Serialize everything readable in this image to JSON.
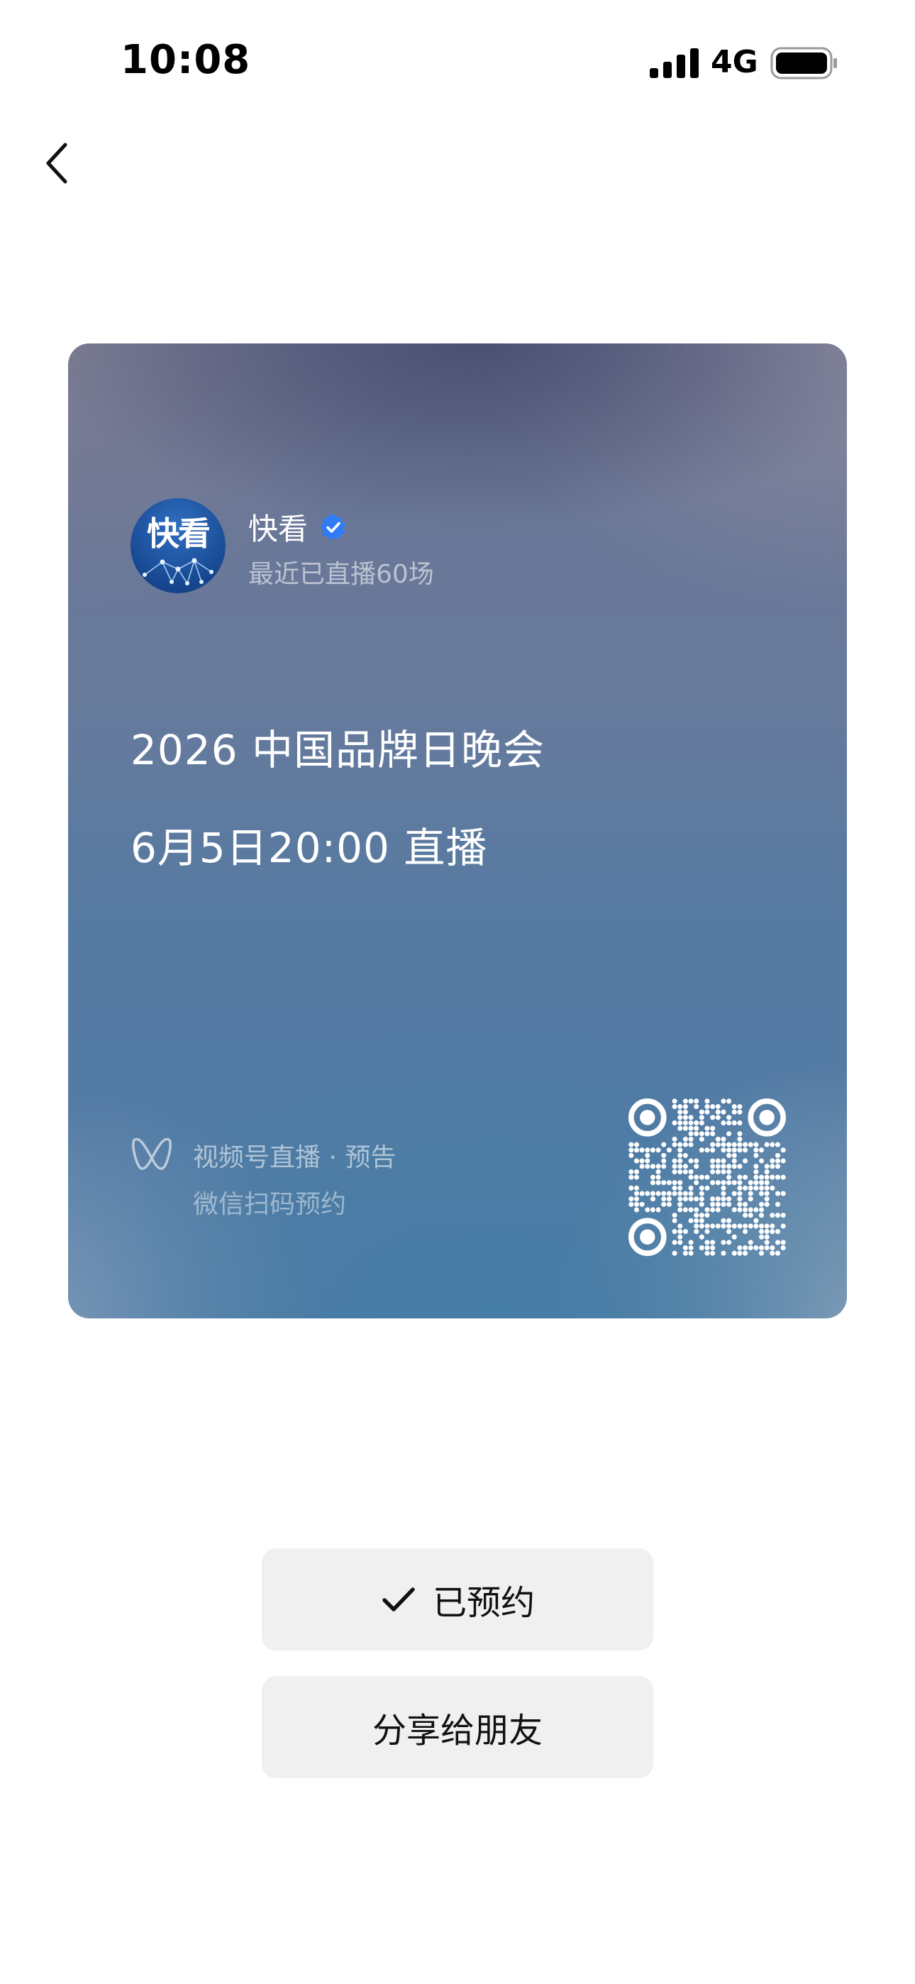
{
  "status_bar": {
    "time": "10:08",
    "network": "4G",
    "icons": [
      "signal-icon",
      "battery-icon"
    ]
  },
  "nav": {
    "back_icon": "chevron-left-icon"
  },
  "card": {
    "avatar_text": "快看",
    "channel_name": "快看",
    "verified_icon": "verified-badge-icon",
    "live_count": "最近已直播60场",
    "event_title": "2026 中国品牌日晚会",
    "event_time": "6月5日20:00 直播",
    "footer_icon": "channels-logo-icon",
    "footer_title": "视频号直播 · 预告",
    "footer_subtitle": "微信扫码预约",
    "qr_icon": "qr-code-icon"
  },
  "actions": {
    "reserved_label": "已预约",
    "reserved_icon": "checkmark-icon",
    "share_label": "分享给朋友"
  },
  "colors": {
    "verified": "#2f7cf6",
    "button_bg": "#f0f0f0",
    "card_top": "#6b7392",
    "card_bottom": "#4f7ba6"
  }
}
